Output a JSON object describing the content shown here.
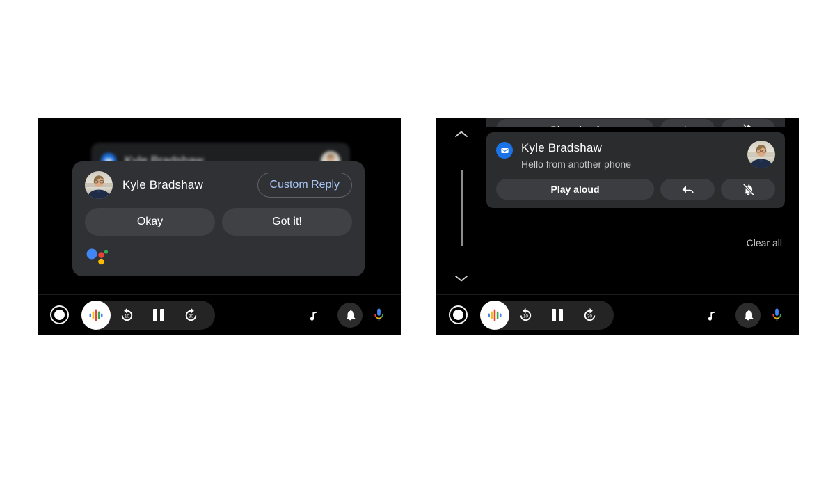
{
  "screens": [
    {
      "id": "left",
      "name": "assistant-reply-dialog-screen",
      "background_card": {
        "sender": "Kyle Bradshaw",
        "app_icon": "message-icon",
        "avatar": "contact-avatar"
      },
      "dialog": {
        "sender": "Kyle Bradshaw",
        "custom_reply_label": "Custom Reply",
        "quick_replies": [
          "Okay",
          "Got it!"
        ],
        "assistant_indicator": "google-assistant-dots",
        "accent_color": "#a7c5f5",
        "surface_color": "#303134"
      }
    },
    {
      "id": "right",
      "name": "notification-center-screen",
      "scrollbar": {
        "up_label": "scroll-up",
        "down_label": "scroll-down"
      },
      "partial_card": {
        "play_aloud_label": "Play aloud"
      },
      "notification": {
        "app_icon": "message-icon",
        "sender": "Kyle Bradshaw",
        "message": "Hello from another phone",
        "avatar": "contact-avatar",
        "actions": [
          {
            "label": "Play aloud",
            "icon": ""
          },
          {
            "label": "",
            "icon": "reply-arrow-icon"
          },
          {
            "label": "",
            "icon": "bell-off-icon"
          }
        ]
      },
      "clear_all_label": "Clear all"
    }
  ],
  "toolbar": {
    "items": [
      {
        "name": "home-button",
        "icon": "circle-icon"
      },
      {
        "name": "assistant-button",
        "icon": "google-assistant-icon"
      },
      {
        "name": "rewind-button",
        "icon": "replay-10-icon",
        "label": "10"
      },
      {
        "name": "play-pause-button",
        "icon": "pause-icon"
      },
      {
        "name": "forward-button",
        "icon": "forward-30-icon",
        "label": "30"
      },
      {
        "name": "music-button",
        "icon": "music-note-icon"
      },
      {
        "name": "notifications-button",
        "icon": "bell-icon"
      },
      {
        "name": "microphone-button",
        "icon": "microphone-icon"
      }
    ]
  },
  "colors": {
    "page_background": "#ffffff",
    "screen_background": "#000000",
    "card_surface": "#2a2c2e",
    "chip_surface": "#3b3d40",
    "accent_blue": "#1b73e8",
    "link_blue": "#a7c5f5"
  }
}
